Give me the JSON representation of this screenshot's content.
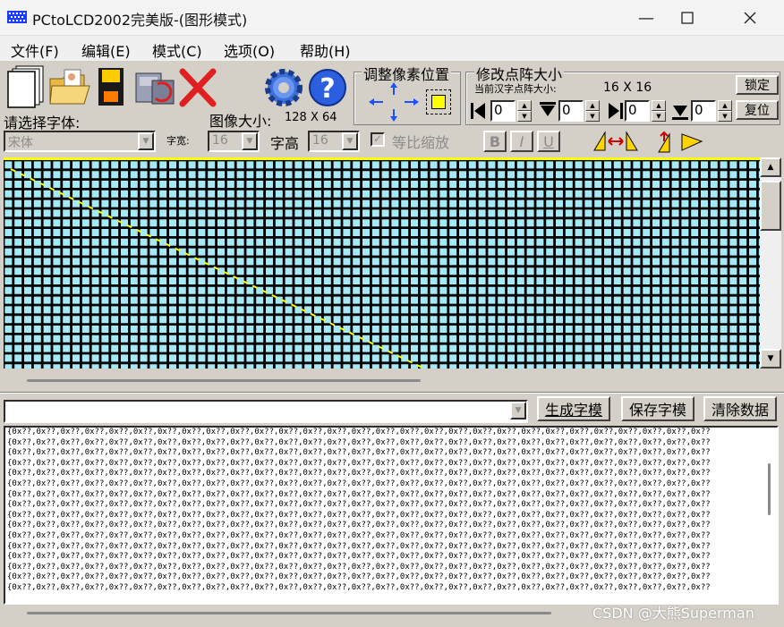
{
  "window": {
    "title": "PCtoLCD2002完美版-(图形模式)"
  },
  "menu": [
    "文件(F)",
    "编辑(E)",
    "模式(C)",
    "选项(O)",
    "帮助(H)"
  ],
  "font_panel": {
    "select_font_label": "请选择字体:",
    "font_value": "宋体",
    "width_label": "字宽:",
    "width_value": "16",
    "height_label": "字高",
    "height_value": "16",
    "proportional_label": "等比缩放",
    "image_size_label": "图像大小:",
    "image_size_value": "128 X 64"
  },
  "pixel_panel": {
    "title": "调整像素位置"
  },
  "matrix_panel": {
    "title": "修改点阵大小",
    "current_label": "当前汉字点阵大小:",
    "current_value": "16 X 16",
    "lock_button": "锁定",
    "reset_button": "复位",
    "spin_values": [
      "0",
      "0",
      "0",
      "0"
    ]
  },
  "style_buttons": [
    "B",
    "I",
    "U"
  ],
  "actions": {
    "generate_button": "生成字模",
    "save_button": "保存字模",
    "clear_button": "清除数据"
  },
  "output": {
    "line": "{0x??,0x??,0x??,0x??,0x??,0x??,0x??,0x??,0x??,0x??,0x??,0x??,0x??,0x??,0x??,0x??,0x??,0x??,0x??,0x??,0x??,0x??,0x??,0x??,0x??,0x??,0x??,0x??,0x??",
    "line_count": 16
  },
  "watermark": "CSDN @大熊Superman",
  "colors": {
    "grid_cell": "#a4e9f5",
    "grid_line": "#000000",
    "highlight": "#ffff00",
    "face": "#d4d0c8"
  }
}
